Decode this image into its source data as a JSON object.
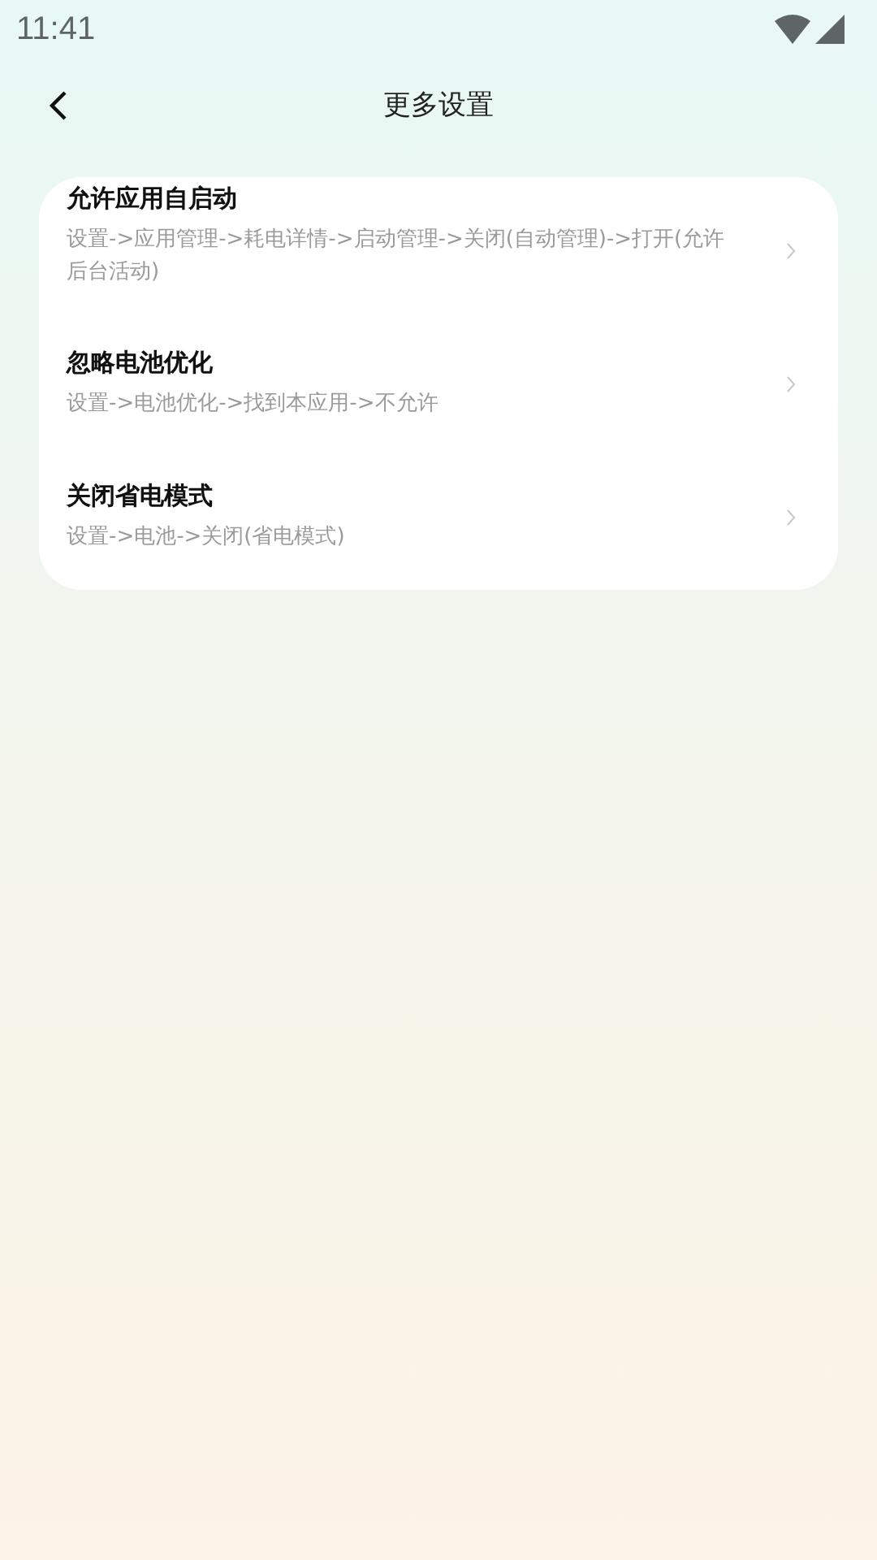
{
  "status_bar": {
    "time": "11:41"
  },
  "header": {
    "title": "更多设置"
  },
  "settings": [
    {
      "title": "允许应用自启动",
      "description": "设置->应用管理->耗电详情->启动管理->关闭(自动管理)->打开(允许后台活动)"
    },
    {
      "title": "忽略电池优化",
      "description": "设置->电池优化->找到本应用->不允许"
    },
    {
      "title": "关闭省电模式",
      "description": "设置->电池->关闭(省电模式)"
    }
  ]
}
